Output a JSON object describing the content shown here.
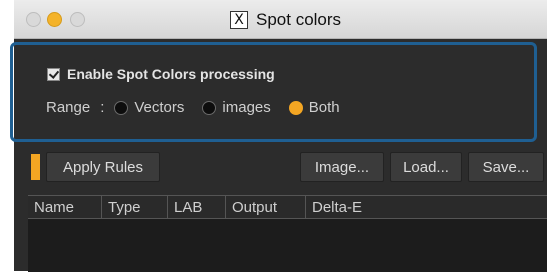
{
  "window": {
    "title": "Spot colors",
    "title_icon": "x-window-icon"
  },
  "spot_colors": {
    "enable_label": "Enable Spot Colors processing",
    "enable_checked": true,
    "range_label": "Range",
    "range_colon": ":",
    "range_options": [
      "Vectors",
      "images",
      "Both"
    ],
    "range_selected": "Both"
  },
  "toolbar": {
    "apply_label": "Apply Rules",
    "image_label": "Image...",
    "load_label": "Load...",
    "save_label": "Save..."
  },
  "table": {
    "columns": [
      "Name",
      "Type",
      "LAB",
      "Output",
      "Delta-E"
    ],
    "rows": []
  },
  "colors": {
    "accent": "#f4a623",
    "highlight_border": "#1f5f92",
    "panel_background": "#2c2c2c"
  }
}
